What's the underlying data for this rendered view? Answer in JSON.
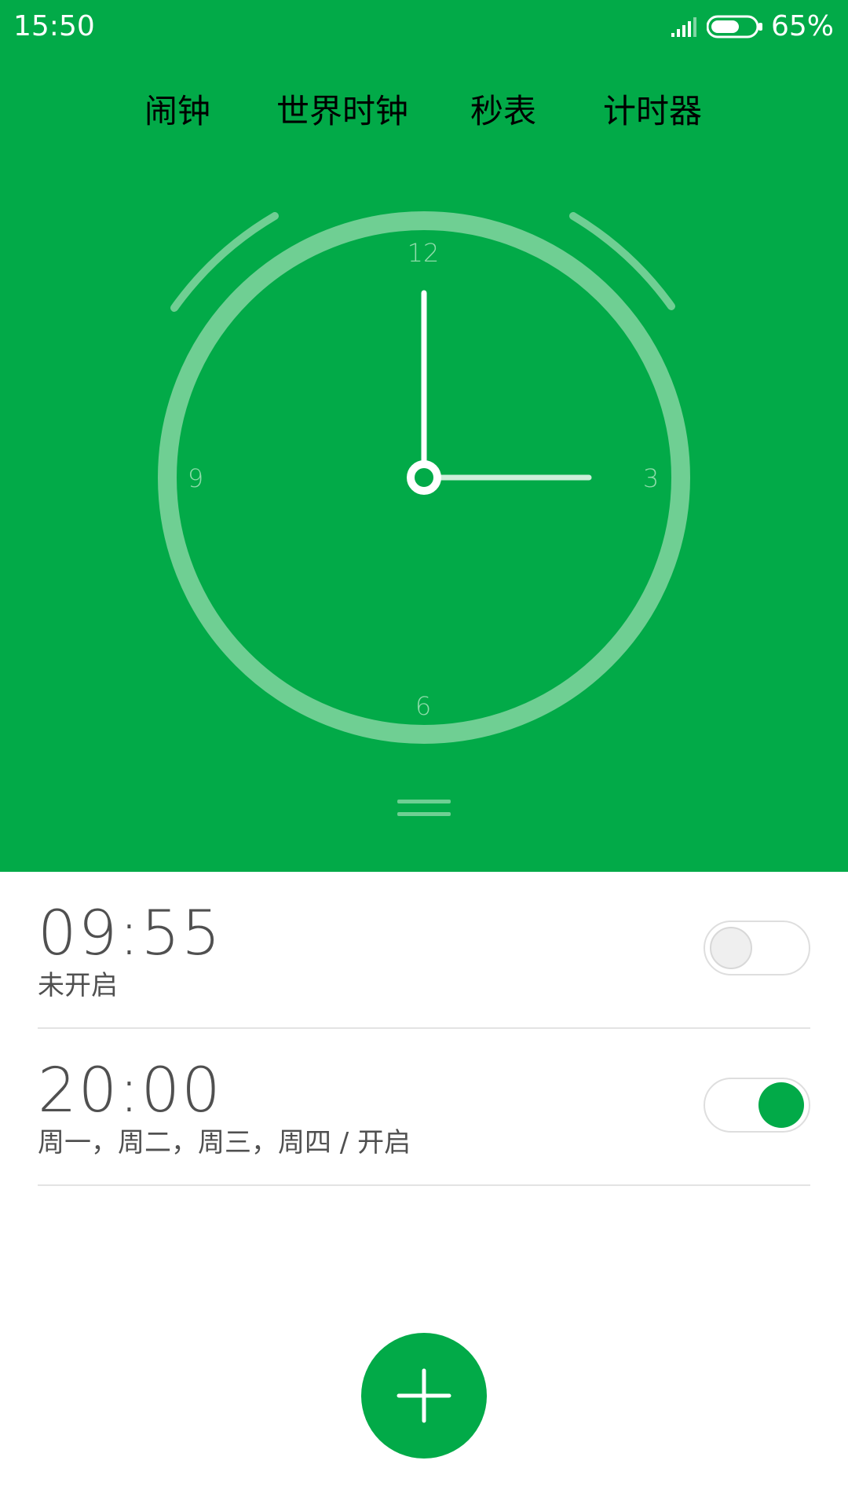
{
  "status_bar": {
    "time": "15:50",
    "battery_percent": "65%",
    "battery_level": 0.65,
    "signal_icon": "cellular-signal-icon",
    "battery_icon": "battery-icon"
  },
  "tabs": [
    {
      "label": "闹钟",
      "active": true
    },
    {
      "label": "世界时钟",
      "active": false
    },
    {
      "label": "秒表",
      "active": false
    },
    {
      "label": "计时器",
      "active": false
    }
  ],
  "clock": {
    "numerals": {
      "n12": "12",
      "n3": "3",
      "n6": "6",
      "n9": "9"
    },
    "hour": 3,
    "minute": 0,
    "drag_handle_icon": "drag-handle-icon"
  },
  "alarms": [
    {
      "time": "09:55",
      "subtitle": "未开启",
      "enabled": false
    },
    {
      "time": "20:00",
      "subtitle": "周一，周二，周三，周四 / 开启",
      "enabled": true
    }
  ],
  "fab": {
    "icon": "add-icon"
  },
  "colors": {
    "accent": "#02aa48",
    "ring": "#6fcf93",
    "inactive_tab": "#8fdcaa",
    "text": "#505050"
  }
}
